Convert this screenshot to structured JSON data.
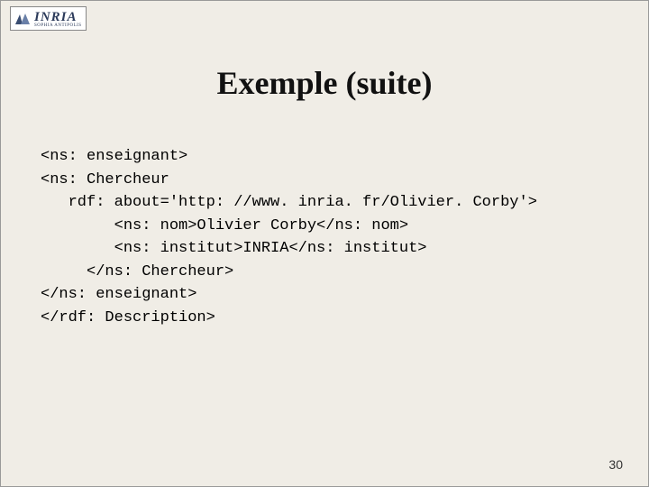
{
  "logo": {
    "text": "INRIA",
    "subtitle": "SOPHIA ANTIPOLIS"
  },
  "title": "Exemple (suite)",
  "code": {
    "line1": "<ns: enseignant>",
    "line2": "<ns: Chercheur",
    "line3": "   rdf: about='http: //www. inria. fr/Olivier. Corby'>",
    "line4": "        <ns: nom>Olivier Corby</ns: nom>",
    "line5": "        <ns: institut>INRIA</ns: institut>",
    "line6": "     </ns: Chercheur>",
    "line7": "</ns: enseignant>",
    "line8": "</rdf: Description>"
  },
  "page_number": "30"
}
